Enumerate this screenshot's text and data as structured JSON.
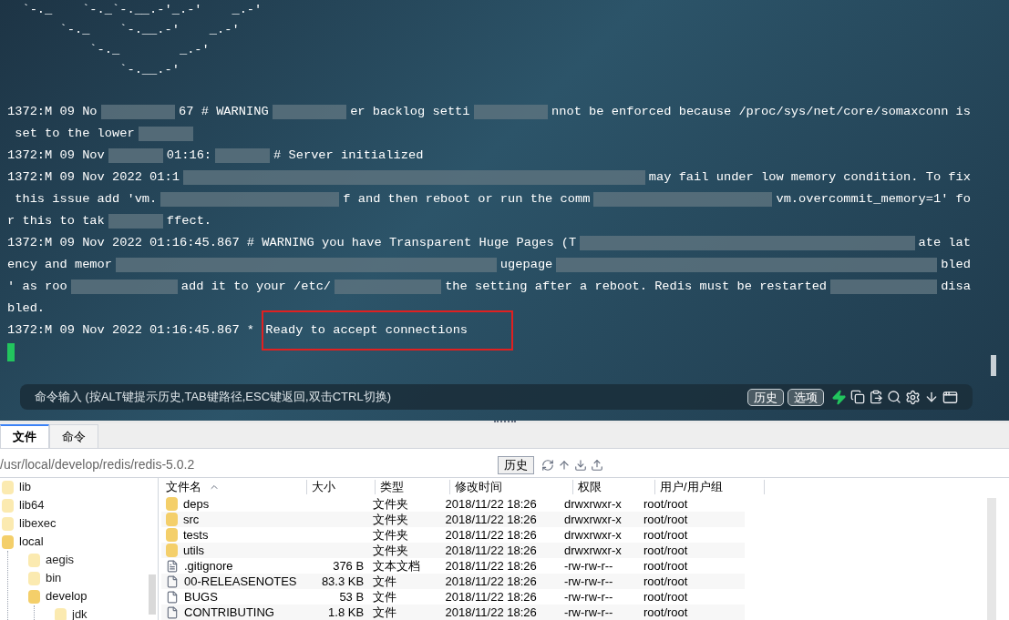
{
  "terminal": {
    "banner": [
      "  `-._    `-._`-.__.-'_.-'    _.-'",
      "       `-._    `-.__.-'    _.-'",
      "           `-._        _.-'",
      "               `-.__.-'"
    ],
    "lines": [
      {
        "wraps": true,
        "segments": [
          {
            "kind": "text",
            "text": "1372:M 09 No"
          },
          {
            "kind": "redacted"
          },
          {
            "kind": "text",
            "text": "67 # WARNING"
          },
          {
            "kind": "redacted"
          },
          {
            "kind": "text",
            "text": "er backlog setti"
          },
          {
            "kind": "redacted"
          },
          {
            "kind": "text",
            "text": "nnot be enforced because /proc/sys/net/core/somaxconn is"
          }
        ]
      },
      {
        "wraps": false,
        "segments": [
          {
            "kind": "text",
            "text": " set to the lower"
          },
          {
            "kind": "redacted"
          }
        ]
      },
      {
        "wraps": false,
        "segments": [
          {
            "kind": "text",
            "text": "1372:M 09 Nov"
          },
          {
            "kind": "redacted"
          },
          {
            "kind": "text",
            "text": "01:16:"
          },
          {
            "kind": "redacted"
          },
          {
            "kind": "text",
            "text": "# Server initialized"
          }
        ]
      },
      {
        "wraps": true,
        "segments": [
          {
            "kind": "text",
            "text": "1372:M 09 Nov 2022 01:1"
          },
          {
            "kind": "redacted"
          },
          {
            "kind": "text",
            "text": "may fail under low memory condition. To fix"
          }
        ]
      },
      {
        "wraps": true,
        "segments": [
          {
            "kind": "text",
            "text": " this issue add 'vm."
          },
          {
            "kind": "redacted"
          },
          {
            "kind": "text",
            "text": "f and then reboot or run the comm"
          },
          {
            "kind": "redacted"
          },
          {
            "kind": "text",
            "text": "vm.overcommit_memory=1' fo"
          }
        ]
      },
      {
        "wraps": false,
        "segments": [
          {
            "kind": "text",
            "text": "r this to tak"
          },
          {
            "kind": "redacted"
          },
          {
            "kind": "text",
            "text": "ffect."
          }
        ]
      },
      {
        "wraps": true,
        "segments": [
          {
            "kind": "text",
            "text": "1372:M 09 Nov 2022 01:16:45.867 # WARNING you have Transparent Huge Pages (T"
          },
          {
            "kind": "redacted"
          },
          {
            "kind": "text",
            "text": "ate lat"
          }
        ]
      },
      {
        "wraps": true,
        "segments": [
          {
            "kind": "text",
            "text": "ency and memor"
          },
          {
            "kind": "redacted"
          },
          {
            "kind": "text",
            "text": "ugepage"
          },
          {
            "kind": "redacted"
          },
          {
            "kind": "text",
            "text": "bled"
          }
        ]
      },
      {
        "wraps": true,
        "segments": [
          {
            "kind": "text",
            "text": "' as roo"
          },
          {
            "kind": "redacted"
          },
          {
            "kind": "text",
            "text": "add it to your /etc/"
          },
          {
            "kind": "redacted"
          },
          {
            "kind": "text",
            "text": "the setting after a reboot. Redis must be restarted"
          },
          {
            "kind": "redacted"
          },
          {
            "kind": "text",
            "text": "disa"
          }
        ]
      },
      {
        "segments": [
          {
            "kind": "text",
            "text": "bled."
          }
        ]
      },
      {
        "segments": [
          {
            "kind": "text",
            "text": "1372:M 09 Nov 2022 01:16:45.867 * "
          },
          {
            "kind": "highlight",
            "text": "Ready to accept connections"
          }
        ]
      }
    ]
  },
  "command_bar": {
    "placeholder": "命令输入 (按ALT键提示历史,TAB键路径,ESC键返回,双击CTRL切换)",
    "buttons": [
      "历史",
      "选项"
    ]
  },
  "tabs": [
    {
      "label": "文件",
      "selected": true
    },
    {
      "label": "命令",
      "selected": false
    }
  ],
  "path_bar": {
    "path": "/usr/local/develop/redis/redis-5.0.2",
    "button": "历史"
  },
  "tree": [
    {
      "name": "lib",
      "expanded": false
    },
    {
      "name": "lib64",
      "expanded": false
    },
    {
      "name": "libexec",
      "expanded": false
    },
    {
      "name": "local",
      "expanded": true,
      "children": [
        {
          "name": "aegis",
          "expanded": false
        },
        {
          "name": "bin",
          "expanded": false
        },
        {
          "name": "develop",
          "expanded": true,
          "children": [
            {
              "name": "jdk",
              "expanded": false
            }
          ]
        }
      ]
    }
  ],
  "table": {
    "columns": [
      {
        "label": "文件名",
        "sorted": true
      },
      {
        "label": "大小",
        "sorted": false
      },
      {
        "label": "类型",
        "sorted": false
      },
      {
        "label": "修改时间",
        "sorted": false
      },
      {
        "label": "权限",
        "sorted": false
      },
      {
        "label": "用户/用户组",
        "sorted": false
      }
    ],
    "rows": [
      {
        "kind": "folder",
        "name": "deps",
        "size": "",
        "type": "文件夹",
        "modified": "2018/11/22 18:26",
        "perm": "drwxrwxr-x",
        "owner": "root/root"
      },
      {
        "kind": "folder",
        "name": "src",
        "size": "",
        "type": "文件夹",
        "modified": "2018/11/22 18:26",
        "perm": "drwxrwxr-x",
        "owner": "root/root"
      },
      {
        "kind": "folder",
        "name": "tests",
        "size": "",
        "type": "文件夹",
        "modified": "2018/11/22 18:26",
        "perm": "drwxrwxr-x",
        "owner": "root/root"
      },
      {
        "kind": "folder",
        "name": "utils",
        "size": "",
        "type": "文件夹",
        "modified": "2018/11/22 18:26",
        "perm": "drwxrwxr-x",
        "owner": "root/root"
      },
      {
        "kind": "text",
        "name": ".gitignore",
        "size": "376 B",
        "type": "文本文档",
        "modified": "2018/11/22 18:26",
        "perm": "-rw-rw-r--",
        "owner": "root/root"
      },
      {
        "kind": "file",
        "name": "00-RELEASENOTES",
        "size": "83.3 KB",
        "type": "文件",
        "modified": "2018/11/22 18:26",
        "perm": "-rw-rw-r--",
        "owner": "root/root"
      },
      {
        "kind": "file",
        "name": "BUGS",
        "size": "53 B",
        "type": "文件",
        "modified": "2018/11/22 18:26",
        "perm": "-rw-rw-r--",
        "owner": "root/root"
      },
      {
        "kind": "file",
        "name": "CONTRIBUTING",
        "size": "1.8 KB",
        "type": "文件",
        "modified": "2018/11/22 18:26",
        "perm": "-rw-rw-r--",
        "owner": "root/root"
      }
    ]
  }
}
